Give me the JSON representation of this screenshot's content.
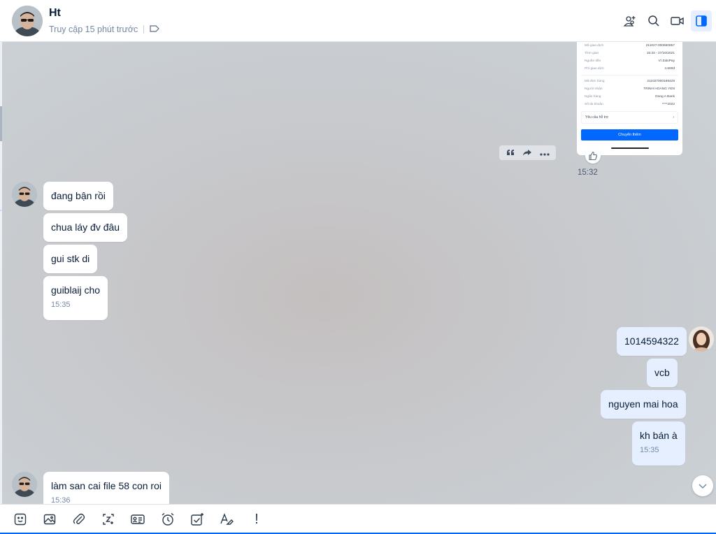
{
  "header": {
    "name": "Ht",
    "status": "Truy cập 15 phút trước",
    "icons": [
      "add-member-icon",
      "search-icon",
      "video-call-icon",
      "sidebar-toggle-icon"
    ]
  },
  "screenshot_card": {
    "rows_top": [
      {
        "label": "Mã giao dịch",
        "value": "211027-000660857"
      },
      {
        "label": "Thời gian",
        "value": "15:33 - 27/10/2021"
      },
      {
        "label": "Nguồn tiền",
        "value": "Ví ZaloPay"
      },
      {
        "label": "Phí giao dịch",
        "value": "4.600đ"
      }
    ],
    "rows_bottom": [
      {
        "label": "Mã đơn hàng",
        "value": "211027000169429"
      },
      {
        "label": "Người nhận",
        "value": "TRINH HOANG YEN"
      },
      {
        "label": "Ngân hàng",
        "value": "Dong A Bank"
      },
      {
        "label": "Số tài khoản",
        "value": "****2022"
      }
    ],
    "support": "Yêu cầu hỗ trợ",
    "button": "Chuyển thêm",
    "time": "15:32"
  },
  "messages_left": [
    {
      "text": "đang bận rồi"
    },
    {
      "text": "chua láy đv đâu"
    },
    {
      "text": "gui stk di"
    },
    {
      "text": "guiblaij cho",
      "time": "15:35"
    },
    {
      "text": "làm san cai file 58 con roi",
      "time": "15:36"
    }
  ],
  "messages_right": [
    {
      "text": "1014594322"
    },
    {
      "text": "vcb"
    },
    {
      "text": "nguyen mai hoa"
    },
    {
      "text": "kh bán à",
      "time": "15:35"
    }
  ],
  "toolbar": {
    "icons": [
      "sticker-icon",
      "image-icon",
      "attachment-icon",
      "screenshot-icon",
      "contact-card-icon",
      "reminder-icon",
      "task-icon",
      "text-format-icon",
      "urgent-icon"
    ],
    "urgent_label": "!"
  },
  "colors": {
    "accent": "#0068ff",
    "my_bubble": "#e5efff",
    "their_bubble": "#ffffff"
  }
}
